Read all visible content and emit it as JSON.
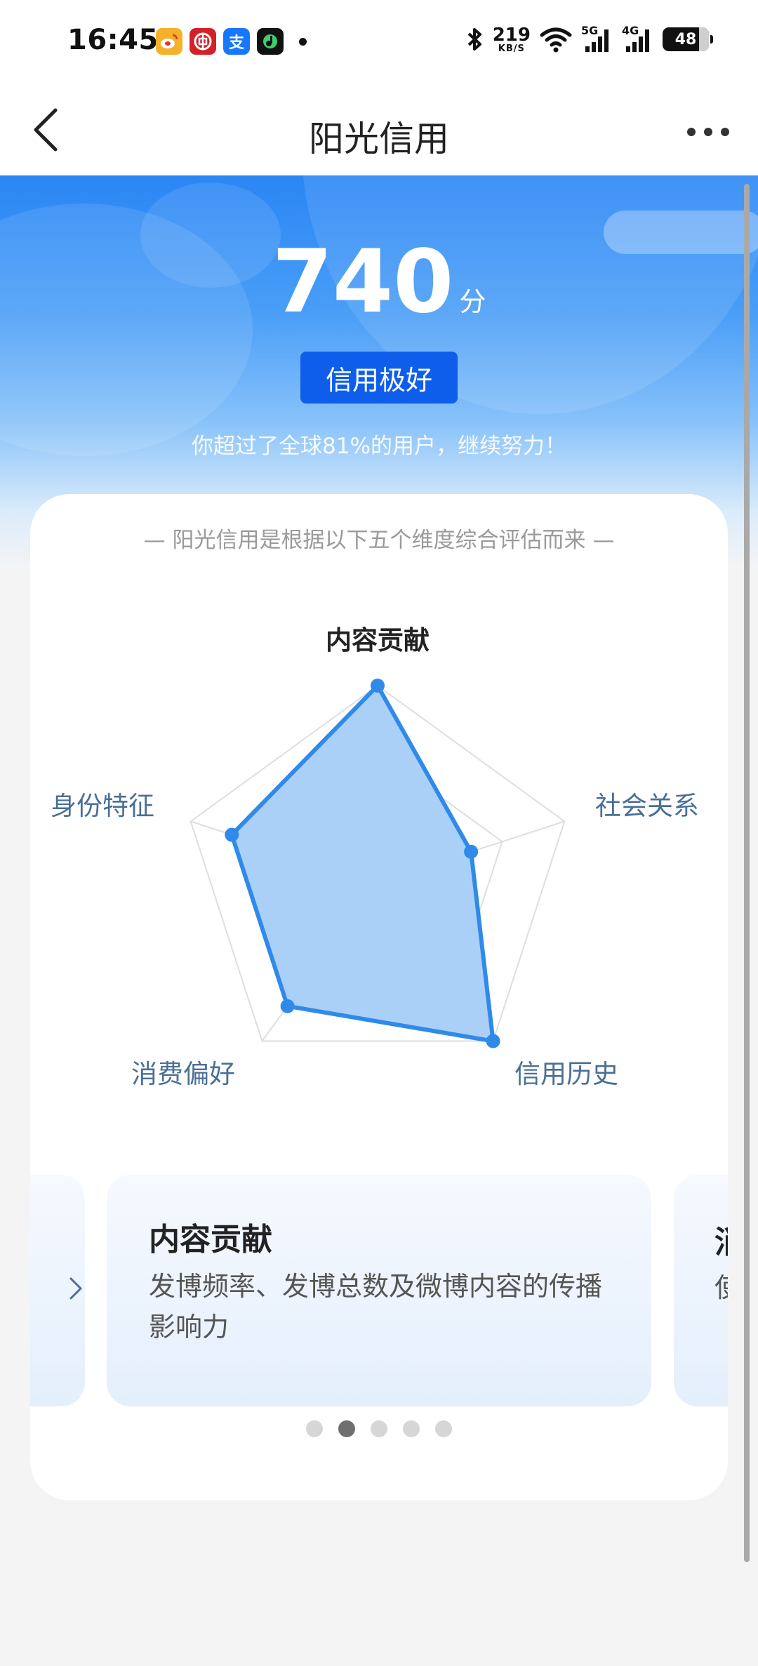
{
  "status_bar": {
    "time": "16:45",
    "apps": [
      {
        "icon": "weibo-icon",
        "glyph": "",
        "color": "#f5b12a"
      },
      {
        "icon": "bank-icon",
        "glyph": "",
        "color": "#d42128"
      },
      {
        "icon": "alipay-icon",
        "glyph": "支",
        "color": "#1677ff"
      },
      {
        "icon": "music-icon",
        "glyph": "",
        "color": "#111111"
      }
    ],
    "net_speed_value": "219",
    "net_speed_unit": "KB/S",
    "signal_1": "5G",
    "signal_2": "4G",
    "battery": "48"
  },
  "nav": {
    "title": "阳光信用"
  },
  "hero": {
    "score": "740",
    "score_unit": "分",
    "level": "信用极好",
    "beat_text": "你超过了全球81%的用户，继续努力！"
  },
  "card": {
    "intro": "— 阳光信用是根据以下五个维度综合评估而来 —",
    "dimensions": [
      {
        "label": "内容贡献",
        "value": 1.0
      },
      {
        "label": "社会关系",
        "value": 0.5
      },
      {
        "label": "信用历史",
        "value": 1.0
      },
      {
        "label": "消费偏好",
        "value": 0.78
      },
      {
        "label": "身份特征",
        "value": 0.78
      }
    ],
    "active_dimension": 0,
    "slide": {
      "title": "内容贡献",
      "desc": "发博频率、发博总数及微博内容的传播影响力"
    },
    "next_slide": {
      "title_fragment": "消",
      "desc_fragment": "使"
    },
    "page_count": 5,
    "active_page": 1
  },
  "colors": {
    "accent": "#2f8ae9",
    "fill": "#a6cdf7",
    "badge": "#0f5eeb",
    "label": "#4a6f97"
  }
}
